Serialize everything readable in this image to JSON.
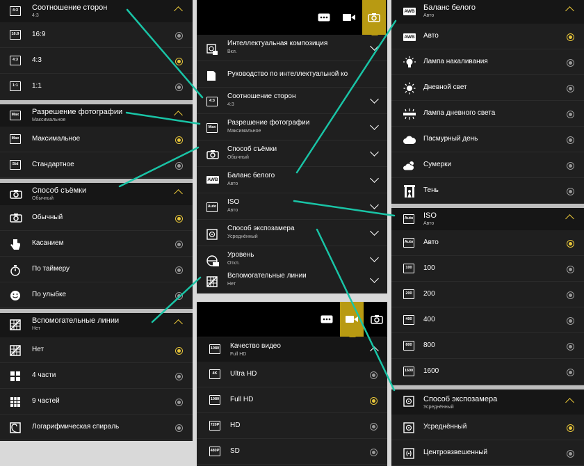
{
  "colors": {
    "accent": "#e8c63a",
    "callout": "#19c4a6",
    "panel": "#1f1f1f",
    "header": "#161616"
  },
  "left": {
    "aspect": {
      "title": "Соотношение сторон",
      "sub": "4:3",
      "icon": "4:3",
      "options": [
        {
          "icon": "16:9",
          "label": "16:9",
          "selected": false
        },
        {
          "icon": "4:3",
          "label": "4:3",
          "selected": true
        },
        {
          "icon": "1:1",
          "label": "1:1",
          "selected": false
        }
      ]
    },
    "resolution": {
      "title": "Разрешение фотографии",
      "sub": "Максимальное",
      "icon": "Max",
      "options": [
        {
          "icon": "Max",
          "label": "Максимальное",
          "selected": true
        },
        {
          "icon": "Std",
          "label": "Стандартное",
          "selected": false
        }
      ]
    },
    "shoot": {
      "title": "Способ съёмки",
      "sub": "Обычный",
      "options": [
        {
          "label": "Обычный",
          "selected": true
        },
        {
          "label": "Касанием",
          "selected": false
        },
        {
          "label": "По таймеру",
          "selected": false
        },
        {
          "label": "По улыбке",
          "selected": false
        }
      ]
    },
    "grid": {
      "title": "Вспомогательные линии",
      "sub": "Нет",
      "options": [
        {
          "label": "Нет",
          "selected": true
        },
        {
          "label": "4 части",
          "selected": false
        },
        {
          "label": "9 частей",
          "selected": false
        },
        {
          "label": "Логарифмическая спираль",
          "selected": false
        }
      ]
    }
  },
  "middle": {
    "menu": [
      {
        "title": "Интеллектуальная композиция",
        "sub": "Вкл."
      },
      {
        "title": "Руководство по интеллектуальной ко",
        "sub": ""
      },
      {
        "title": "Соотношение сторон",
        "sub": "4:3",
        "icon": "4:3"
      },
      {
        "title": "Разрешение фотографии",
        "sub": "Максимальное",
        "icon": "Max"
      },
      {
        "title": "Способ съёмки",
        "sub": "Обычный"
      },
      {
        "title": "Баланс белого",
        "sub": "Авто",
        "icon": "AWB"
      },
      {
        "title": "ISO",
        "sub": "Авто",
        "icon": "Auto"
      },
      {
        "title": "Способ экспозамера",
        "sub": "Усреднённый"
      },
      {
        "title": "Уровень",
        "sub": "Откл."
      },
      {
        "title": "Вспомогательные линии",
        "sub": "Нет"
      }
    ],
    "video": {
      "title": "Качество видео",
      "sub": "Full HD",
      "icon": "1080",
      "options": [
        {
          "icon": "4K",
          "label": "Ultra HD",
          "selected": false
        },
        {
          "icon": "1080",
          "label": "Full HD",
          "selected": true
        },
        {
          "icon": "720P",
          "label": "HD",
          "selected": false
        },
        {
          "icon": "480P",
          "label": "SD",
          "selected": false
        }
      ]
    }
  },
  "right": {
    "wb": {
      "title": "Баланс белого",
      "sub": "Авто",
      "icon": "AWB",
      "options": [
        {
          "icon": "AWB",
          "label": "Авто",
          "selected": true
        },
        {
          "label": "Лампа накаливания",
          "selected": false
        },
        {
          "label": "Дневной свет",
          "selected": false
        },
        {
          "label": "Лампа дневного света",
          "selected": false
        },
        {
          "label": "Пасмурный день",
          "selected": false
        },
        {
          "label": "Сумерки",
          "selected": false
        },
        {
          "label": "Тень",
          "selected": false
        }
      ]
    },
    "iso": {
      "title": "ISO",
      "sub": "Авто",
      "icon": "Auto",
      "options": [
        {
          "icon": "Auto",
          "label": "Авто",
          "selected": true
        },
        {
          "icon": "100",
          "label": "100",
          "selected": false
        },
        {
          "icon": "200",
          "label": "200",
          "selected": false
        },
        {
          "icon": "400",
          "label": "400",
          "selected": false
        },
        {
          "icon": "800",
          "label": "800",
          "selected": false
        },
        {
          "icon": "1600",
          "label": "1600",
          "selected": false
        }
      ]
    },
    "meter": {
      "title": "Способ экспозамера",
      "sub": "Усреднённый",
      "options": [
        {
          "label": "Усреднённый",
          "selected": true
        },
        {
          "label": "Центровзвешенный",
          "selected": false
        }
      ]
    }
  }
}
